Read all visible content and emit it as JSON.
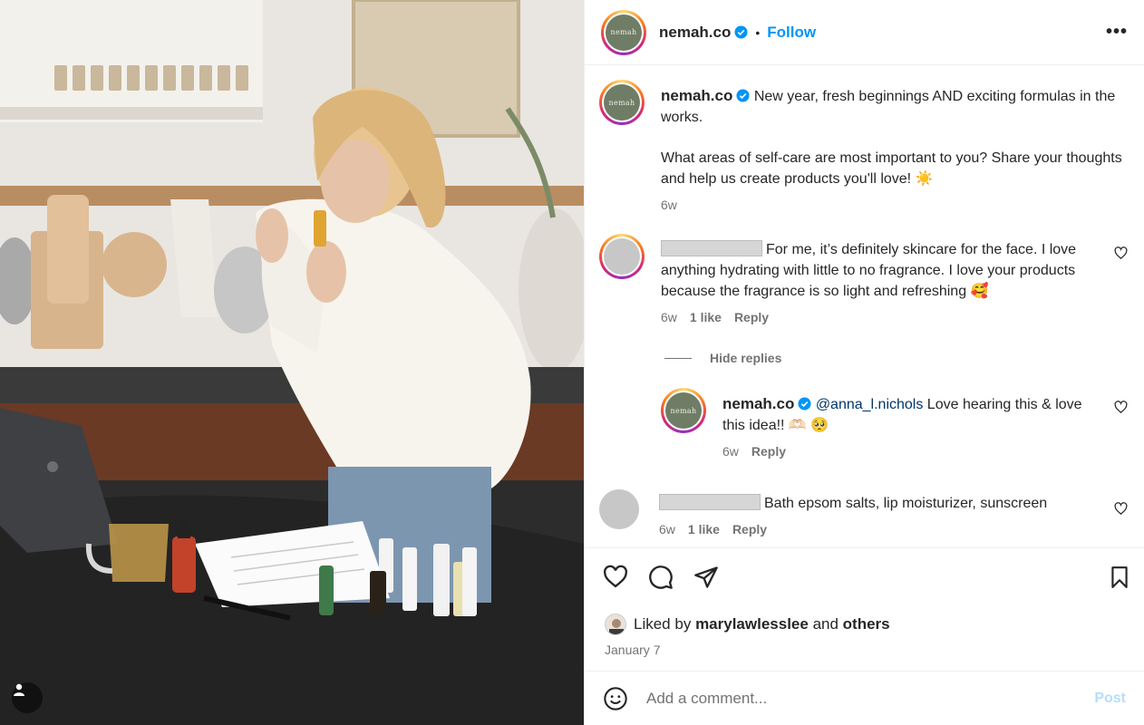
{
  "post": {
    "username": "nemah.co",
    "avatar_text": "nemah",
    "follow_label": "Follow",
    "more_label": "•••",
    "separator": "•"
  },
  "caption": {
    "username": "nemah.co",
    "line1": "New year, fresh beginnings AND exciting formulas in the works.",
    "line2": "What areas of self-care are most important to you? Share your thoughts and help us create products you'll love! ☀️",
    "time": "6w"
  },
  "comments": [
    {
      "text": "For me, it’s definitely skincare for the face. I love anything hydrating with little to no fragrance. I love your products because the fragrance is so light and refreshing 🥰",
      "time": "6w",
      "likes": "1 like",
      "reply_label": "Reply"
    },
    {
      "text": "Bath epsom salts, lip moisturizer, sunscreen",
      "time": "6w",
      "likes": "1 like",
      "reply_label": "Reply"
    }
  ],
  "hide_replies_label": "Hide replies",
  "reply": {
    "username": "nemah.co",
    "mention": "@anna_l.nichols",
    "text": " Love hearing this & love this idea!! 🫶🏻 🥺",
    "time": "6w",
    "reply_label": "Reply"
  },
  "likes": {
    "prefix": "Liked by ",
    "user": "marylawlesslee",
    "middle": " and ",
    "suffix": "others"
  },
  "date": "January 7",
  "composer": {
    "placeholder": "Add a comment...",
    "post_label": "Post"
  },
  "colors": {
    "accent": "#0095f6",
    "verified": "#0095f6",
    "brand_green": "#6f7d66",
    "post_disabled": "#b2dffc"
  },
  "icons": [
    "like-icon",
    "comment-icon",
    "share-icon",
    "save-icon",
    "emoji-icon",
    "verified-icon",
    "more-icon",
    "user-tag-icon"
  ]
}
